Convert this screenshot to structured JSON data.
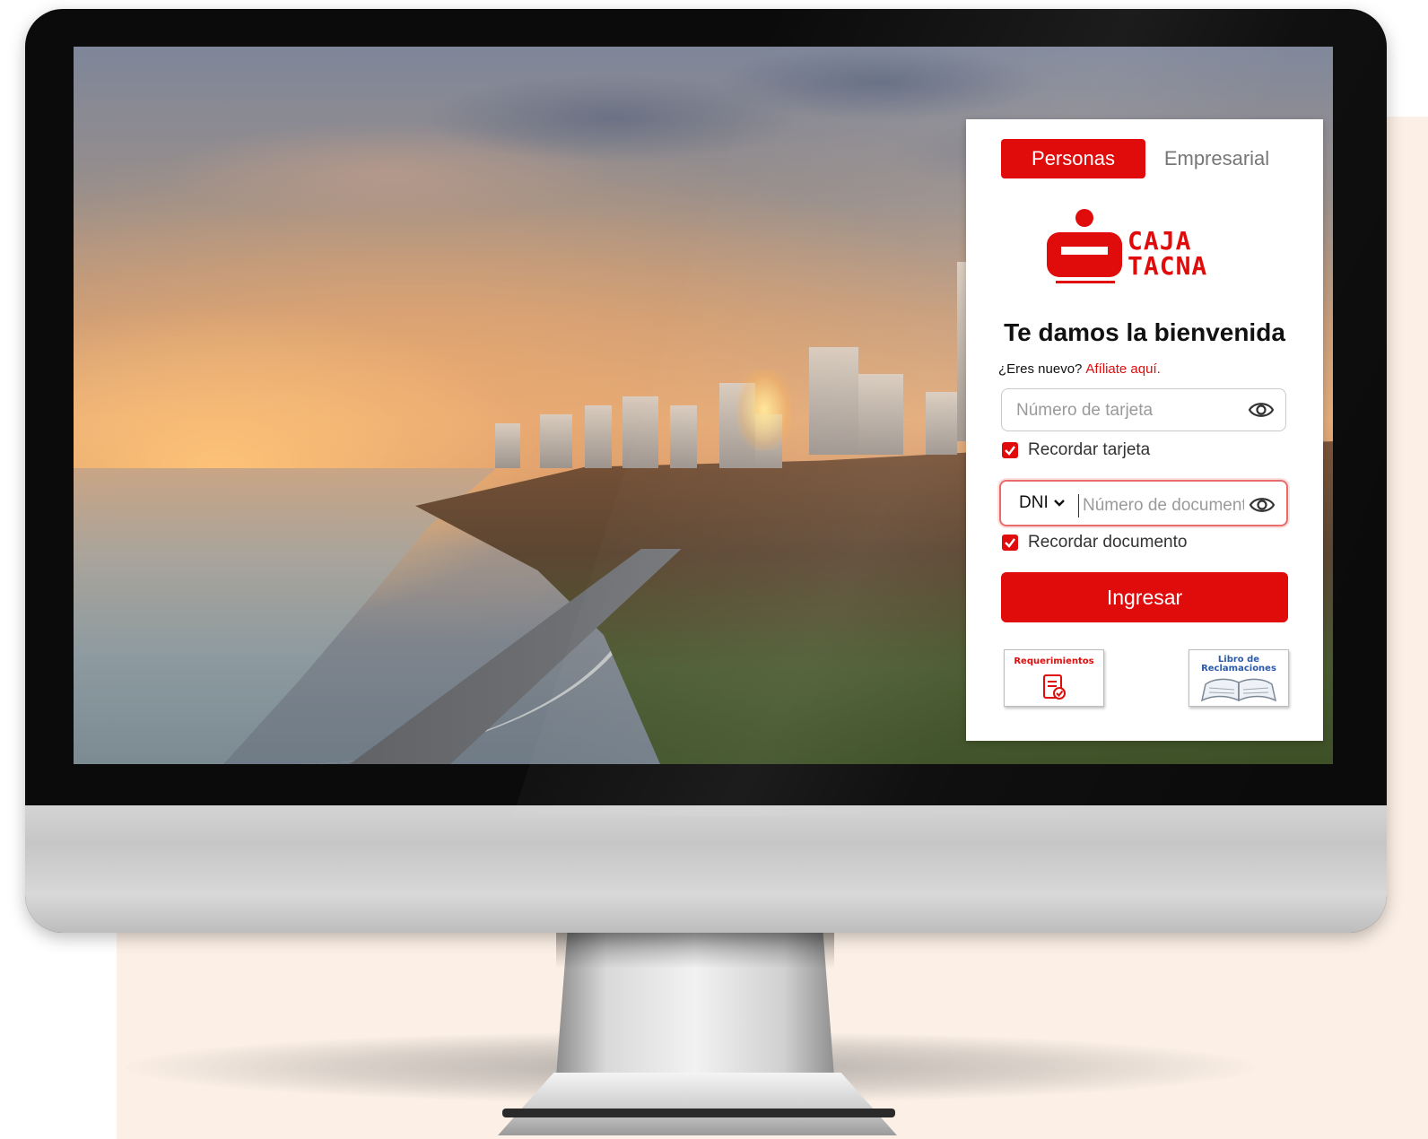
{
  "login": {
    "tabs": [
      {
        "label": "Personas",
        "active": true
      },
      {
        "label": "Empresarial",
        "active": false
      }
    ],
    "brand": {
      "line1": "CAJA",
      "line2": "TACNA",
      "color": "#e00b0b"
    },
    "title": "Te damos la bienvenida",
    "new_user": {
      "text": "¿Eres nuevo?",
      "link": "Afíliate aquí."
    },
    "card_field": {
      "placeholder": "Número de tarjeta",
      "value": ""
    },
    "remember_card": {
      "label": "Recordar tarjeta",
      "checked": true
    },
    "document": {
      "type": "DNI",
      "placeholder": "Número de documento",
      "value": ""
    },
    "remember_document": {
      "label": "Recordar documento",
      "checked": true
    },
    "submit_label": "Ingresar",
    "badges": {
      "requirements": "Requerimientos",
      "complaints_line1": "Libro de",
      "complaints_line2": "Reclamaciones"
    }
  },
  "colors": {
    "accent": "#e00b0b",
    "backdrop": "#fcf0e6",
    "link_blue": "#2a5aa8"
  },
  "icons": [
    "eye-icon",
    "checkmark-icon",
    "document-check-icon",
    "open-book-icon",
    "chevron-down-icon",
    "caja-tacna-logo"
  ]
}
